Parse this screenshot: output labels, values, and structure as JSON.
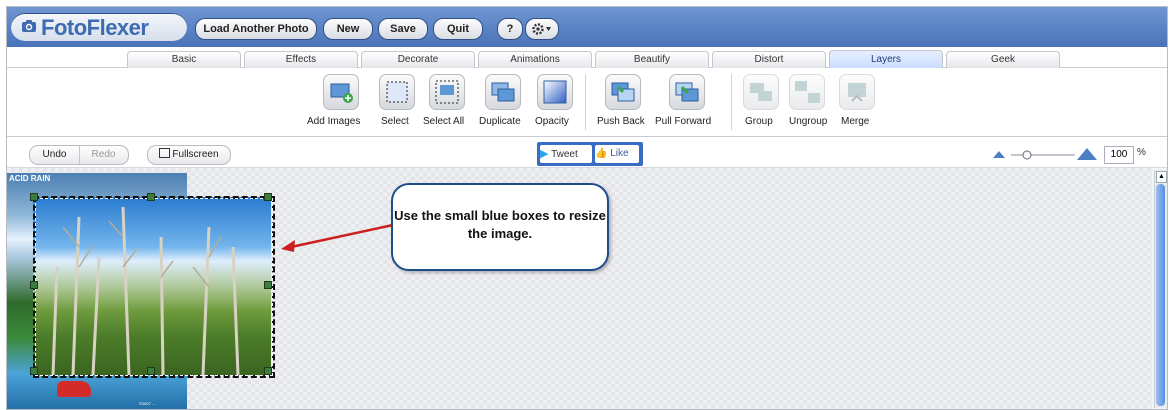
{
  "app": {
    "name": "FotoFlexer"
  },
  "header": {
    "buttons": [
      "Load Another Photo",
      "New",
      "Save",
      "Quit"
    ],
    "help_label": "?"
  },
  "tabs": [
    "Basic",
    "Effects",
    "Decorate",
    "Animations",
    "Beautify",
    "Distort",
    "Layers",
    "Geek"
  ],
  "active_tab": "Layers",
  "toolbar": {
    "tools": [
      "Add Images",
      "Select",
      "Select All",
      "Duplicate",
      "Opacity",
      "Push Back",
      "Pull Forward",
      "Group",
      "Ungroup",
      "Merge"
    ],
    "disabled": [
      "Group",
      "Ungroup",
      "Merge"
    ]
  },
  "actions": {
    "undo": "Undo",
    "redo": "Redo",
    "fullscreen": "Fullscreen",
    "tweet": "Tweet",
    "like": "Like"
  },
  "zoom": {
    "value": "100",
    "unit": "%"
  },
  "canvas": {
    "bg_image_title": "ACID RAIN",
    "bg_image_copyright": "©2007 ..."
  },
  "callout": {
    "text": "Use the small blue boxes to resize the image."
  },
  "colors": {
    "header": "#5b82c2",
    "active_tab": "#c9dcff",
    "callout_border": "#1e4d8c",
    "arrow": "#cc1f1f"
  }
}
